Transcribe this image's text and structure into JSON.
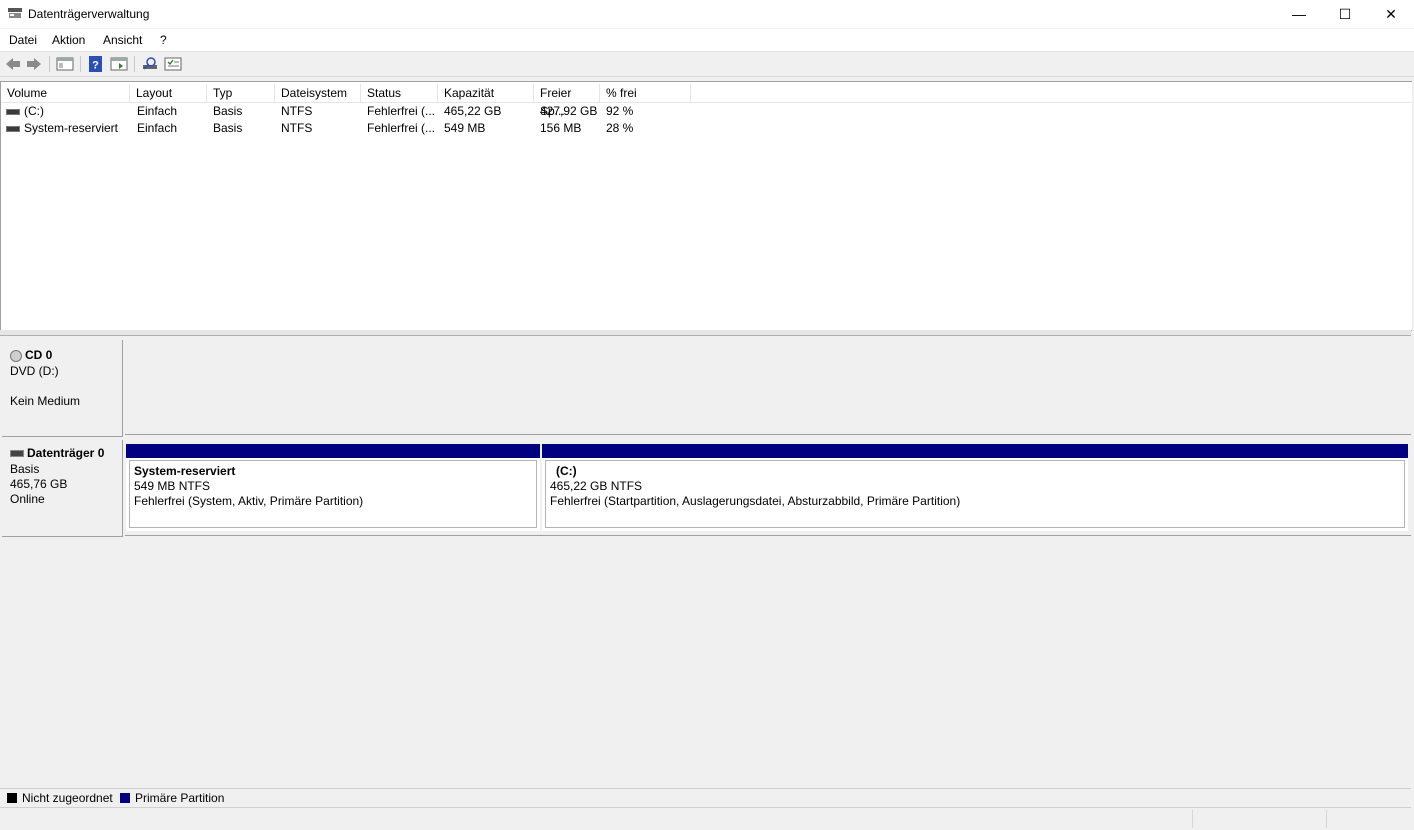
{
  "window": {
    "title": "Datenträgerverwaltung",
    "controls": {
      "minimize": "—",
      "maximize": "☐",
      "close": "✕"
    }
  },
  "menu": [
    "Datei",
    "Aktion",
    "Ansicht",
    "?"
  ],
  "toolbar": {
    "buttons": [
      "back-icon",
      "forward-icon",
      "console-tree-icon",
      "help-icon",
      "show-hide-icon",
      "rescan-icon",
      "properties-icon"
    ]
  },
  "volume_table": {
    "columns": [
      "Volume",
      "Layout",
      "Typ",
      "Dateisystem",
      "Status",
      "Kapazität",
      "Freier Sp...",
      "% frei"
    ],
    "rows": [
      {
        "volume": "(C:)",
        "layout": "Einfach",
        "typ": "Basis",
        "dateisystem": "NTFS",
        "status": "Fehlerfrei (...",
        "kapazitaet": "465,22 GB",
        "frei": "427,92 GB",
        "prozent": "92 %"
      },
      {
        "volume": "System-reserviert",
        "layout": "Einfach",
        "typ": "Basis",
        "dateisystem": "NTFS",
        "status": "Fehlerfrei (...",
        "kapazitaet": "549 MB",
        "frei": "156 MB",
        "prozent": "28 %"
      }
    ]
  },
  "disks": {
    "cd0": {
      "name": "CD 0",
      "type": "DVD (D:)",
      "state": "Kein Medium"
    },
    "disk0": {
      "name": "Datenträger 0",
      "type": "Basis",
      "size": "465,76 GB",
      "state": "Online",
      "partitions": [
        {
          "name": "System-reserviert",
          "size": "549 MB NTFS",
          "status": "Fehlerfrei (System, Aktiv, Primäre Partition)"
        },
        {
          "name": "(C:)",
          "size": "465,22 GB NTFS",
          "status": "Fehlerfrei (Startpartition, Auslagerungsdatei, Absturzabbild, Primäre Partition)"
        }
      ]
    }
  },
  "legend": {
    "unallocated": {
      "label": "Nicht zugeordnet",
      "color": "#000000"
    },
    "primary": {
      "label": "Primäre Partition",
      "color": "#000080"
    }
  }
}
